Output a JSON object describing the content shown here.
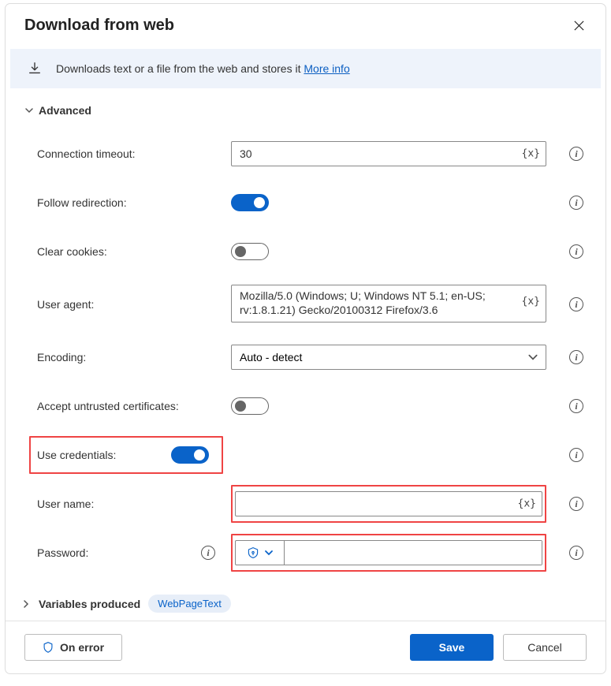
{
  "dialog": {
    "title": "Download from web"
  },
  "banner": {
    "text": "Downloads text or a file from the web and stores it ",
    "more_link": "More info"
  },
  "section": {
    "advanced": "Advanced",
    "variables_produced": "Variables produced"
  },
  "fields": {
    "connection_timeout": {
      "label": "Connection timeout:",
      "value": "30",
      "token": "{x}"
    },
    "follow_redirection": {
      "label": "Follow redirection:",
      "on": true
    },
    "clear_cookies": {
      "label": "Clear cookies:",
      "on": false
    },
    "user_agent": {
      "label": "User agent:",
      "value": "Mozilla/5.0 (Windows; U; Windows NT 5.1; en-US; rv:1.8.1.21) Gecko/20100312 Firefox/3.6",
      "token": "{x}"
    },
    "encoding": {
      "label": "Encoding:",
      "value": "Auto - detect"
    },
    "accept_untrusted": {
      "label": "Accept untrusted certificates:",
      "on": false
    },
    "use_credentials": {
      "label": "Use credentials:",
      "on": true
    },
    "user_name": {
      "label": "User name:",
      "value": "",
      "token": "{x}"
    },
    "password": {
      "label": "Password:",
      "value": ""
    }
  },
  "variables": {
    "badge": "WebPageText"
  },
  "footer": {
    "on_error": "On error",
    "save": "Save",
    "cancel": "Cancel"
  }
}
